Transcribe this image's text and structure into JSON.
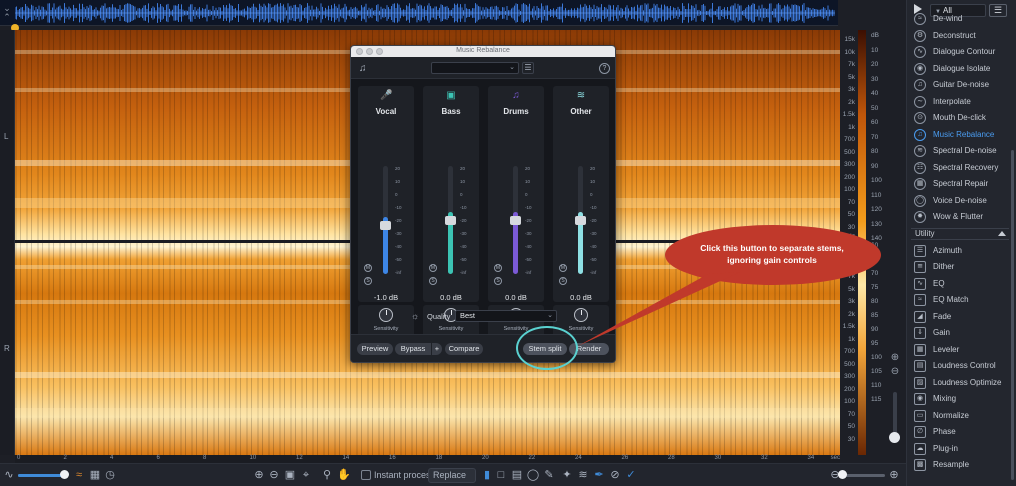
{
  "channels": {
    "left": "L",
    "right": "R"
  },
  "freq_scale_a": [
    "15k",
    "10k",
    "7k",
    "5k",
    "3k",
    "2k",
    "1.5k",
    "1k",
    "700",
    "500",
    "300",
    "200",
    "100",
    "70",
    "50",
    "30",
    "15k",
    "10k",
    "7k",
    "5k",
    "3k",
    "2k",
    "1.5k",
    "1k",
    "700",
    "500",
    "300",
    "200",
    "100",
    "70",
    "50",
    "30"
  ],
  "freq_scale_a_unit": "Hz",
  "db_scale": [
    "dB",
    "10",
    "20",
    "30",
    "40",
    "50",
    "60",
    "70",
    "80",
    "90",
    "100",
    "110",
    "120",
    "130",
    "140",
    "60",
    "65",
    "70",
    "75",
    "80",
    "85",
    "90",
    "95",
    "100",
    "105",
    "110",
    "115"
  ],
  "time_ruler": {
    "ticks": [
      "0",
      "2",
      "4",
      "6",
      "8",
      "10",
      "12",
      "14",
      "16",
      "18",
      "20",
      "22",
      "24",
      "26",
      "28",
      "30",
      "32",
      "34"
    ],
    "unit": "sec"
  },
  "toolbar": {
    "instant_process_label": "Instant process",
    "mode_select": "Replace"
  },
  "right_panel": {
    "filter_value": "All",
    "menu_icon": "hamburger-icon",
    "modules": [
      {
        "label": "De-wind",
        "icon": "wind-icon"
      },
      {
        "label": "Deconstruct",
        "icon": "deconstruct-icon"
      },
      {
        "label": "Dialogue Contour",
        "icon": "contour-icon"
      },
      {
        "label": "Dialogue Isolate",
        "icon": "isolate-icon"
      },
      {
        "label": "Guitar De-noise",
        "icon": "guitar-icon"
      },
      {
        "label": "Interpolate",
        "icon": "interpolate-icon"
      },
      {
        "label": "Mouth De-click",
        "icon": "mouth-icon"
      },
      {
        "label": "Music Rebalance",
        "icon": "rebalance-icon",
        "active": true
      },
      {
        "label": "Spectral De-noise",
        "icon": "spectral-icon"
      },
      {
        "label": "Spectral Recovery",
        "icon": "recovery-icon"
      },
      {
        "label": "Spectral Repair",
        "icon": "repair-icon"
      },
      {
        "label": "Voice De-noise",
        "icon": "voice-icon"
      },
      {
        "label": "Wow & Flutter",
        "icon": "wow-icon"
      }
    ],
    "utility_section": "Utility",
    "utility_modules": [
      {
        "label": "Azimuth",
        "icon": "azimuth-icon"
      },
      {
        "label": "Dither",
        "icon": "dither-icon"
      },
      {
        "label": "EQ",
        "icon": "eq-icon"
      },
      {
        "label": "EQ Match",
        "icon": "eq-match-icon"
      },
      {
        "label": "Fade",
        "icon": "fade-icon"
      },
      {
        "label": "Gain",
        "icon": "gain-icon"
      },
      {
        "label": "Leveler",
        "icon": "leveler-icon"
      },
      {
        "label": "Loudness Control",
        "icon": "loudness-icon"
      },
      {
        "label": "Loudness Optimize",
        "icon": "optimize-icon"
      },
      {
        "label": "Mixing",
        "icon": "mixing-icon"
      },
      {
        "label": "Normalize",
        "icon": "normalize-icon"
      },
      {
        "label": "Phase",
        "icon": "phase-icon"
      },
      {
        "label": "Plug-in",
        "icon": "plugin-icon"
      },
      {
        "label": "Resample",
        "icon": "resample-icon"
      }
    ]
  },
  "dialog": {
    "title": "Music Rebalance",
    "stems": [
      {
        "label": "Vocal",
        "icon": "microphone-icon",
        "color": "#3d86e6",
        "gain": "-1.0 dB",
        "level": 0.45,
        "knob": "Sensitivity"
      },
      {
        "label": "Bass",
        "icon": "speaker-icon",
        "color": "#3cc4b4",
        "gain": "0.0 dB",
        "level": 0.5,
        "knob": "Sensitivity"
      },
      {
        "label": "Drums",
        "icon": "drum-icon",
        "color": "#7b5ad6",
        "gain": "0.0 dB",
        "level": 0.5,
        "knob": "Sensitivity"
      },
      {
        "label": "Other",
        "icon": "waveform-icon",
        "color": "#8ee0e4",
        "gain": "0.0 dB",
        "level": 0.5,
        "knob": "Sensitivity"
      }
    ],
    "fader_ticks": [
      "20",
      "10",
      "0",
      "-10",
      "-20",
      "-30",
      "-40",
      "-50",
      "-inf"
    ],
    "quality_label": "Quality",
    "quality_value": "Best",
    "buttons": {
      "preview": "Preview",
      "bypass": "Bypass",
      "plus": "+",
      "compare": "Compare",
      "stem_split": "Stem split",
      "render": "Render"
    }
  },
  "callout": {
    "text": "Click this button to separate stems, ignoring gain controls",
    "color": "#c0392b"
  }
}
